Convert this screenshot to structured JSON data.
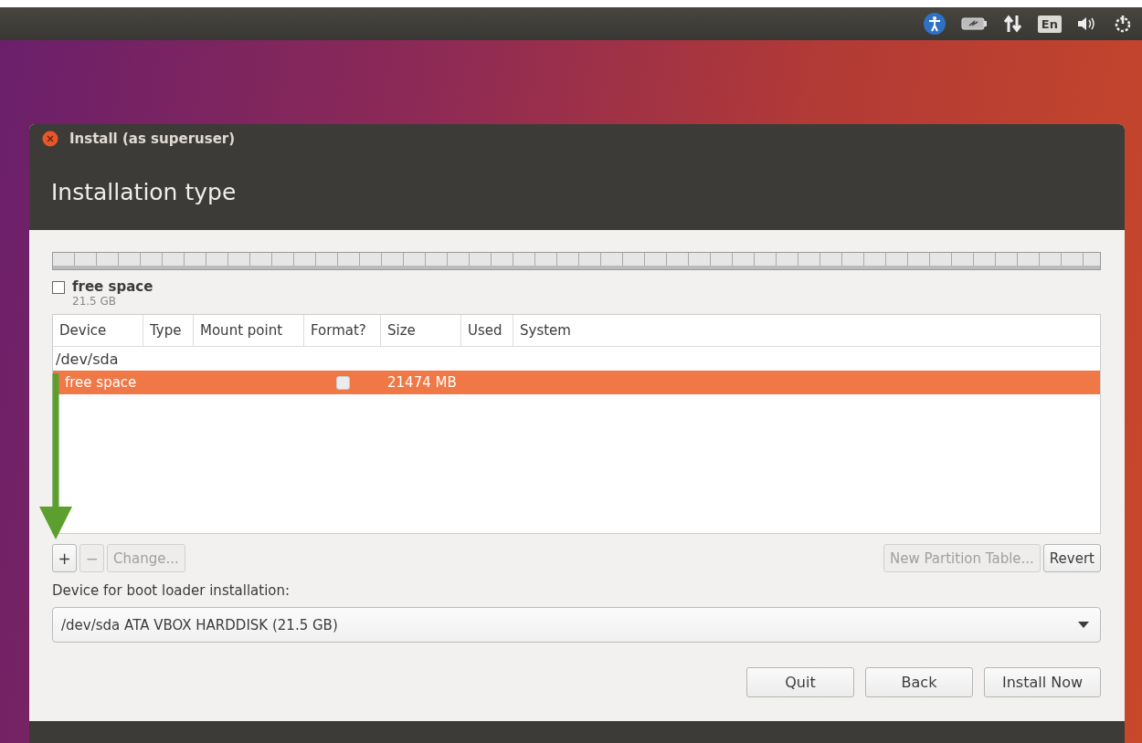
{
  "top_panel": {
    "keyboard_layout": "En"
  },
  "window": {
    "title": "Install (as superuser)",
    "heading": "Installation type"
  },
  "partition_bar": {
    "legend": {
      "label": "free space",
      "size": "21.5 GB"
    }
  },
  "table": {
    "columns": [
      "Device",
      "Type",
      "Mount point",
      "Format?",
      "Size",
      "Used",
      "System"
    ],
    "rows": [
      {
        "kind": "disk",
        "device": "/dev/sda",
        "selected": false
      },
      {
        "kind": "partition",
        "device": "free space",
        "format": false,
        "size": "21474 MB",
        "selected": true
      }
    ]
  },
  "partition_buttons": [
    {
      "kind": "add",
      "label": "+",
      "disabled": false
    },
    {
      "kind": "remove",
      "label": "−",
      "disabled": true
    },
    {
      "kind": "change",
      "label": "Change...",
      "disabled": true
    }
  ],
  "table_buttons": [
    {
      "label": "New Partition Table...",
      "disabled": true
    },
    {
      "label": "Revert",
      "disabled": false
    }
  ],
  "boot_loader": {
    "label": "Device for boot loader installation:",
    "value": "/dev/sda ATA VBOX HARDDISK (21.5 GB)"
  },
  "footer_buttons": [
    {
      "label": "Quit"
    },
    {
      "label": "Back"
    },
    {
      "label": "Install Now"
    }
  ]
}
